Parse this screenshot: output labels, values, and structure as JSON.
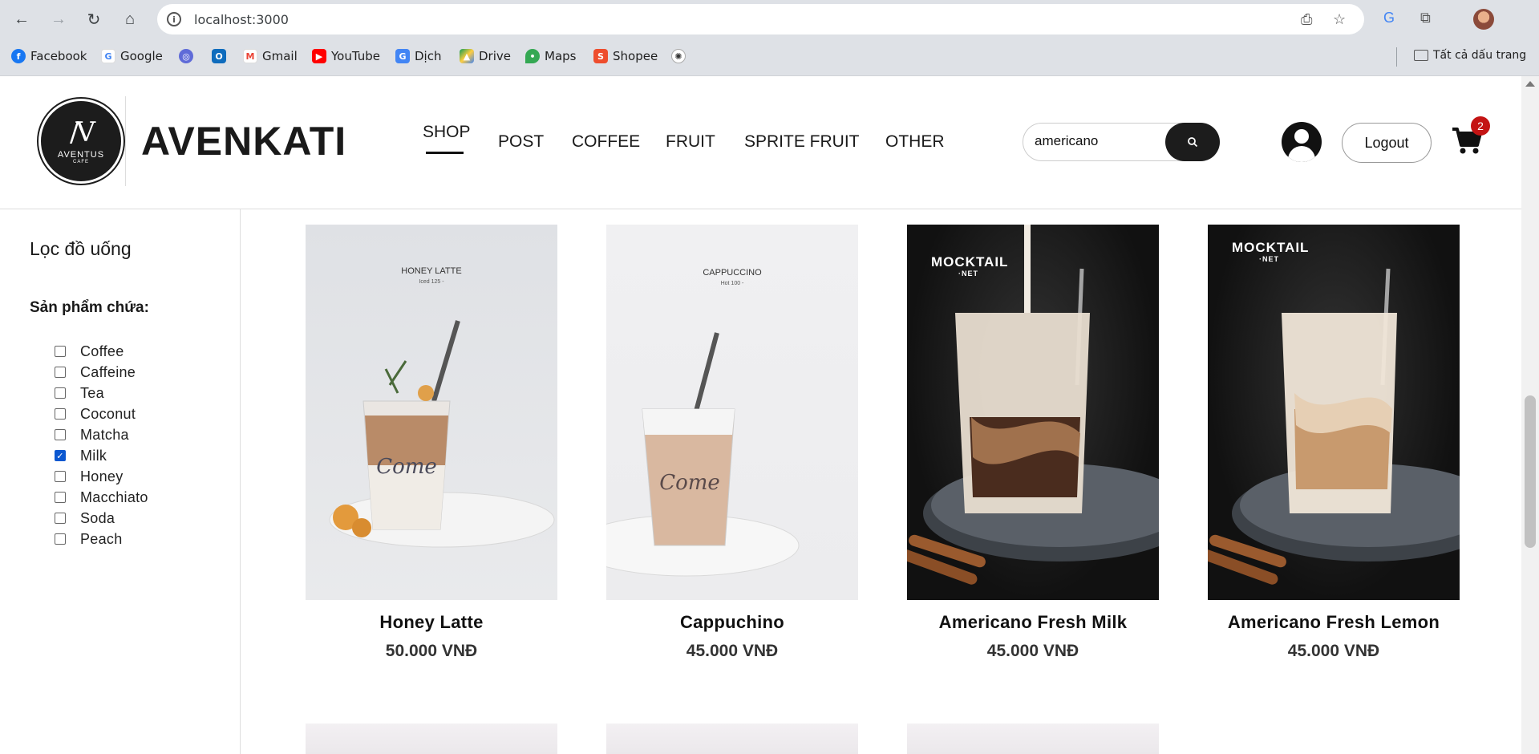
{
  "browser": {
    "url": "localhost:3000",
    "bookmarks": [
      {
        "label": "Facebook",
        "icon": "facebook-icon",
        "color": "#1877f2"
      },
      {
        "label": "Google",
        "icon": "google-icon",
        "color": "#4285f4"
      },
      {
        "label": "",
        "icon": "globe-icon",
        "color": "#5f6bd8"
      },
      {
        "label": "",
        "icon": "outlook-icon",
        "color": "#0f6cbd"
      },
      {
        "label": "Gmail",
        "icon": "gmail-icon",
        "color": "#ea4335"
      },
      {
        "label": "YouTube",
        "icon": "youtube-icon",
        "color": "#ff0000"
      },
      {
        "label": "Dịch",
        "icon": "translate-icon",
        "color": "#4285f4"
      },
      {
        "label": "Drive",
        "icon": "drive-icon",
        "color": "#0f9d58"
      },
      {
        "label": "Maps",
        "icon": "maps-icon",
        "color": "#34a853"
      },
      {
        "label": "Shopee",
        "icon": "shopee-icon",
        "color": "#ee4d2d"
      },
      {
        "label": "",
        "icon": "openai-icon",
        "color": "#333333"
      }
    ],
    "all_bookmarks": "Tất cả dấu trang"
  },
  "header": {
    "brand": "AVENKATI",
    "logo_text": "AVENTUS",
    "logo_sub": "CAFE",
    "nav": [
      "SHOP",
      "POST",
      "COFFEE",
      "FRUIT",
      "SPRITE FRUIT",
      "OTHER"
    ],
    "search_value": "americano",
    "logout": "Logout",
    "cart_count": "2"
  },
  "sidebar": {
    "title": "Lọc đồ uống",
    "subtitle": "Sản phẩm chứa:",
    "filters": [
      {
        "label": "Coffee",
        "checked": false
      },
      {
        "label": "Caffeine",
        "checked": false
      },
      {
        "label": "Tea",
        "checked": false
      },
      {
        "label": "Coconut",
        "checked": false
      },
      {
        "label": "Matcha",
        "checked": false
      },
      {
        "label": "Milk",
        "checked": true
      },
      {
        "label": "Honey",
        "checked": false
      },
      {
        "label": "Macchiato",
        "checked": false
      },
      {
        "label": "Soda",
        "checked": false
      },
      {
        "label": "Peach",
        "checked": false
      }
    ]
  },
  "products": [
    {
      "name": "Honey Latte",
      "price": "50.000 VNĐ",
      "img_label": "HONEY LATTE",
      "img_sub": "Iced 125 -"
    },
    {
      "name": "Cappuchino",
      "price": "45.000 VNĐ",
      "img_label": "CAPPUCCINO",
      "img_sub": "Hot 100 -"
    },
    {
      "name": "Americano Fresh Milk",
      "price": "45.000 VNĐ",
      "img_label": "MOCKTAIL",
      "img_sub": "·NET"
    },
    {
      "name": "Americano Fresh Lemon",
      "price": "45.000 VNĐ",
      "img_label": "MOCKTAIL",
      "img_sub": "·NET"
    }
  ]
}
